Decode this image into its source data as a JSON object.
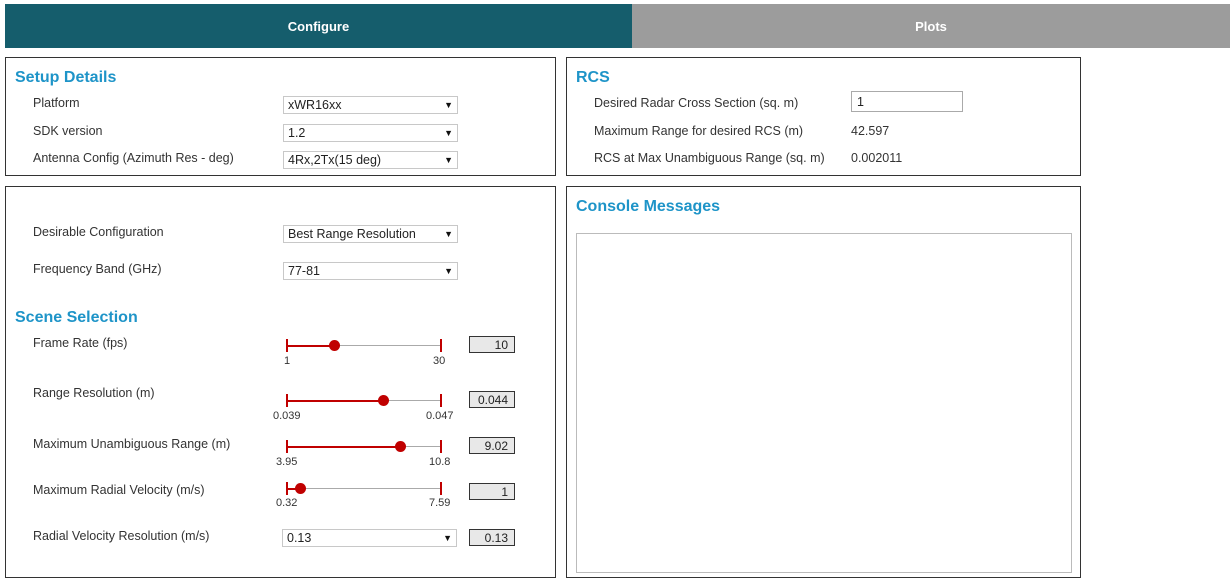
{
  "tabs": {
    "configure": "Configure",
    "plots": "Plots"
  },
  "setup": {
    "title": "Setup Details",
    "platform_label": "Platform",
    "platform_value": "xWR16xx",
    "sdk_label": "SDK version",
    "sdk_value": "1.2",
    "antenna_label": "Antenna Config (Azimuth Res - deg)",
    "antenna_value": "4Rx,2Tx(15 deg)"
  },
  "rcs": {
    "title": "RCS",
    "desired_label": "Desired Radar Cross Section (sq. m)",
    "desired_value": "1",
    "max_range_label": "Maximum Range for desired RCS (m)",
    "max_range_value": "42.597",
    "at_max_label": "RCS at Max Unambiguous Range (sq. m)",
    "at_max_value": "0.002011"
  },
  "config": {
    "desirable_label": "Desirable Configuration",
    "desirable_value": "Best Range Resolution",
    "freq_label": "Frequency Band (GHz)",
    "freq_value": "77-81"
  },
  "scene": {
    "title": "Scene Selection",
    "sliders": [
      {
        "label": "Frame Rate (fps)",
        "min": "1",
        "max": "30",
        "value": "10",
        "fraction": 0.31
      },
      {
        "label": "Range Resolution (m)",
        "min": "0.039",
        "max": "0.047",
        "value": "0.044",
        "fraction": 0.625
      },
      {
        "label": "Maximum Unambiguous Range (m)",
        "min": "3.95",
        "max": "10.8",
        "value": "9.02",
        "fraction": 0.74
      },
      {
        "label": "Maximum Radial Velocity (m/s)",
        "min": "0.32",
        "max": "7.59",
        "value": "1",
        "fraction": 0.09
      }
    ],
    "velocity_res_label": "Radial Velocity Resolution (m/s)",
    "velocity_res_select": "0.13",
    "velocity_res_value": "0.13"
  },
  "console": {
    "title": "Console Messages"
  },
  "icons": {
    "dropdown": "chevron-down-icon"
  },
  "colors": {
    "tab_active": "#155d6c",
    "tab_inactive": "#9c9c9c",
    "heading": "#1e94c8",
    "slider": "#c00000"
  }
}
